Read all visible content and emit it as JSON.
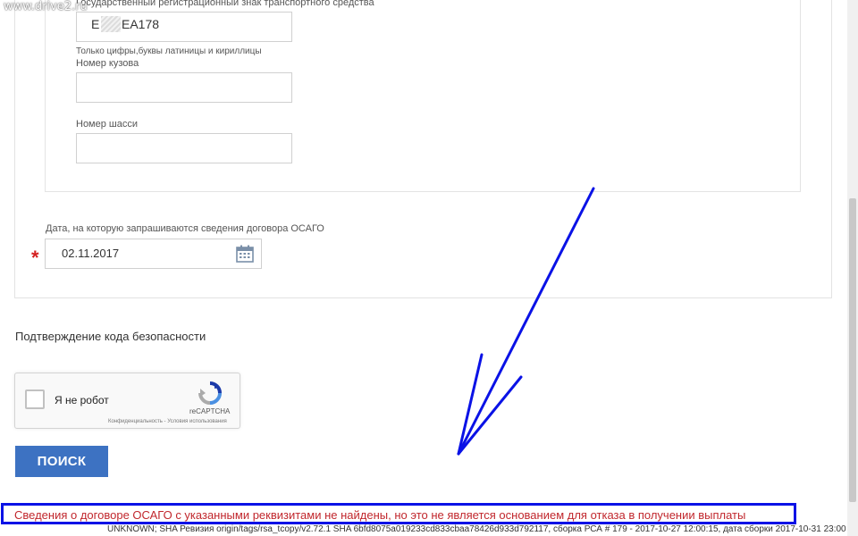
{
  "watermark": "www.drive2.ru",
  "form": {
    "plate_label": "Государственный регистрационный знак транспортного средства",
    "plate_value_prefix": "E",
    "plate_value_suffix": "EA178",
    "plate_hint": "Только цифры,буквы латиницы и кириллицы",
    "body_label": "Номер кузова",
    "body_value": "",
    "chassis_label": "Номер шасси",
    "chassis_value": "",
    "date_label": "Дата, на которую запрашиваются сведения договора ОСАГО",
    "date_value": "02.11.2017",
    "required_mark": "*"
  },
  "security": {
    "title": "Подтверждение кода безопасности",
    "captcha_label": "Я не робот",
    "captcha_brand": "reCAPTCHA",
    "captcha_links": "Конфиденциальность - Условия использования"
  },
  "search_button": "ПОИСК",
  "error_message": "Сведения о договоре ОСАГО с указанными реквизитами не найдены, но это не является основанием для отказа в получении выплаты",
  "footer_text": "UNKNOWN; SHA Ревизия origin/tags/rsa_tcopy/v2.72.1 SHA 6bfd8075a019233cd833cbaa78426d933d792117, сборка РСА # 179 - 2017-10-27 12:00:15, дата сборки 2017-10-31 23:00",
  "colors": {
    "primary_button": "#3d72c2",
    "error_text": "#c1272d",
    "highlight_frame": "#0a12e6",
    "annotation_arrow": "#0a12e6",
    "required": "#d42020"
  },
  "icons": {
    "calendar": "calendar-icon",
    "recaptcha": "recaptcha-logo-icon",
    "arrow": "annotation-arrow"
  }
}
